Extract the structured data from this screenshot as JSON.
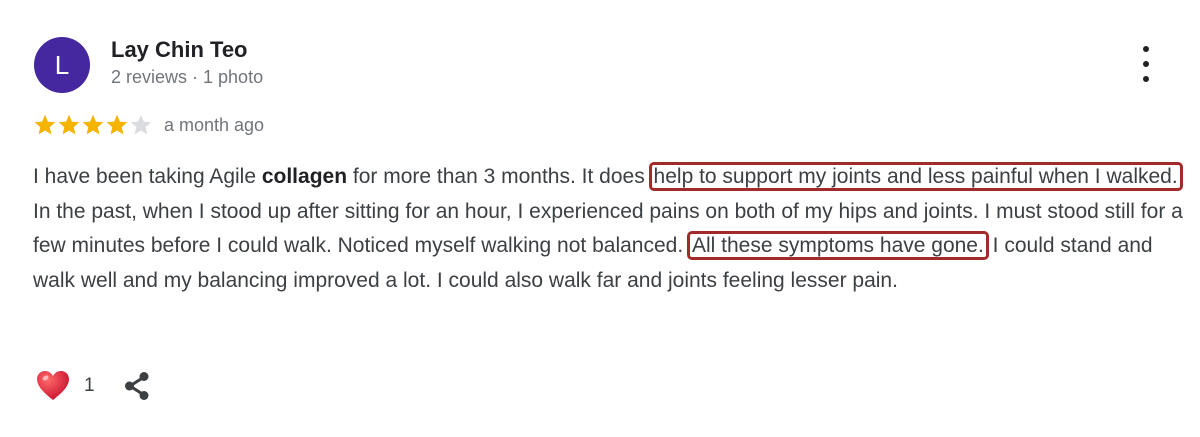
{
  "author": {
    "initial": "L",
    "name": "Lay Chin Teo",
    "meta": "2 reviews · 1 photo",
    "avatar_color": "#4527a0"
  },
  "review": {
    "rating": 4,
    "max_rating": 5,
    "date": "a month ago",
    "segments": [
      {
        "text": "I have been taking Agile ",
        "style": "plain"
      },
      {
        "text": "collagen",
        "style": "bold"
      },
      {
        "text": " for more than 3 months. It does ",
        "style": "plain"
      },
      {
        "text": "help to support my joints and less painful when I walked.",
        "style": "highlight"
      },
      {
        "text": " In the past, when I stood up after sitting for an hour, I experienced pains on both of my hips and joints. I must stood still for a few minutes before I could walk. Noticed myself walking not balanced. ",
        "style": "plain"
      },
      {
        "text": "All these symptoms have gone.",
        "style": "highlight"
      },
      {
        "text": " I could stand and walk well and my balancing improved a lot. I could also walk far and joints feeling lesser pain.",
        "style": "plain"
      }
    ]
  },
  "reactions": {
    "like_count": "1"
  },
  "icons": {
    "more": "more-vert-icon",
    "like": "heart-icon",
    "share": "share-icon",
    "star": "star-icon"
  },
  "colors": {
    "star_filled": "#f4b400",
    "star_empty": "#dadce0",
    "highlight_border": "#a32a2a",
    "heart": "#e0263a"
  }
}
